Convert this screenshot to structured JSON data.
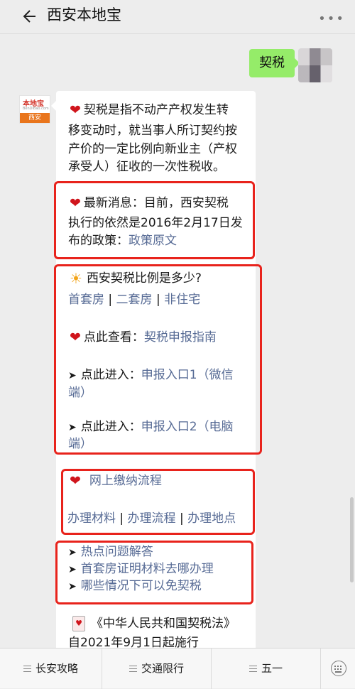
{
  "header": {
    "title": "西安本地宝",
    "back_icon": "arrow-left-icon",
    "more_icon": "more-dots-icon"
  },
  "sent_message": {
    "text": "契税"
  },
  "bot_avatar": {
    "logo_text": "本地宝",
    "logo_sub": "BenDiBao.com",
    "city": "西安"
  },
  "reply": {
    "intro_lines": [
      "契税是指不动产产权发生转",
      "移变动时，就当事人所订契约按",
      "产价的一定比例向新业主（产权",
      "承受人）征收的一次性税收。"
    ],
    "news": {
      "line1": "最新消息：目前，西安契税",
      "line2": "执行的依然是2016年2月17日发",
      "line3_prefix": "布的政策：",
      "line3_link": "政策原文"
    },
    "ratio": {
      "title": "西安契税比例是多少?",
      "links": [
        "首套房",
        "二套房",
        "非住宅"
      ],
      "separator": "|",
      "guide_prefix": "点此查看：",
      "guide_link": "契税申报指南",
      "entry1_prefix": "点此进入：",
      "entry1_link_a": "申报入口1（微信",
      "entry1_link_b": "端）",
      "entry2_prefix": "点此进入：",
      "entry2_link_a": "申报入口2（电脑",
      "entry2_link_b": "端）"
    },
    "online": {
      "title": "网上缴纳流程",
      "links": [
        "办理材料",
        "办理流程",
        "办理地点"
      ]
    },
    "hot": [
      "热点问题解答",
      "首套房证明材料去哪办理",
      "哪些情况下可以免契税"
    ],
    "law": {
      "title": "《中华人民共和国契税法》",
      "line2": "自2021年9月1日起施行"
    }
  },
  "bottom_menu": [
    "长安攻略",
    "交通限行",
    "五一"
  ],
  "colors": {
    "link": "#576b95",
    "highlight_box": "#e8231c",
    "sent_bubble": "#95ec69"
  }
}
